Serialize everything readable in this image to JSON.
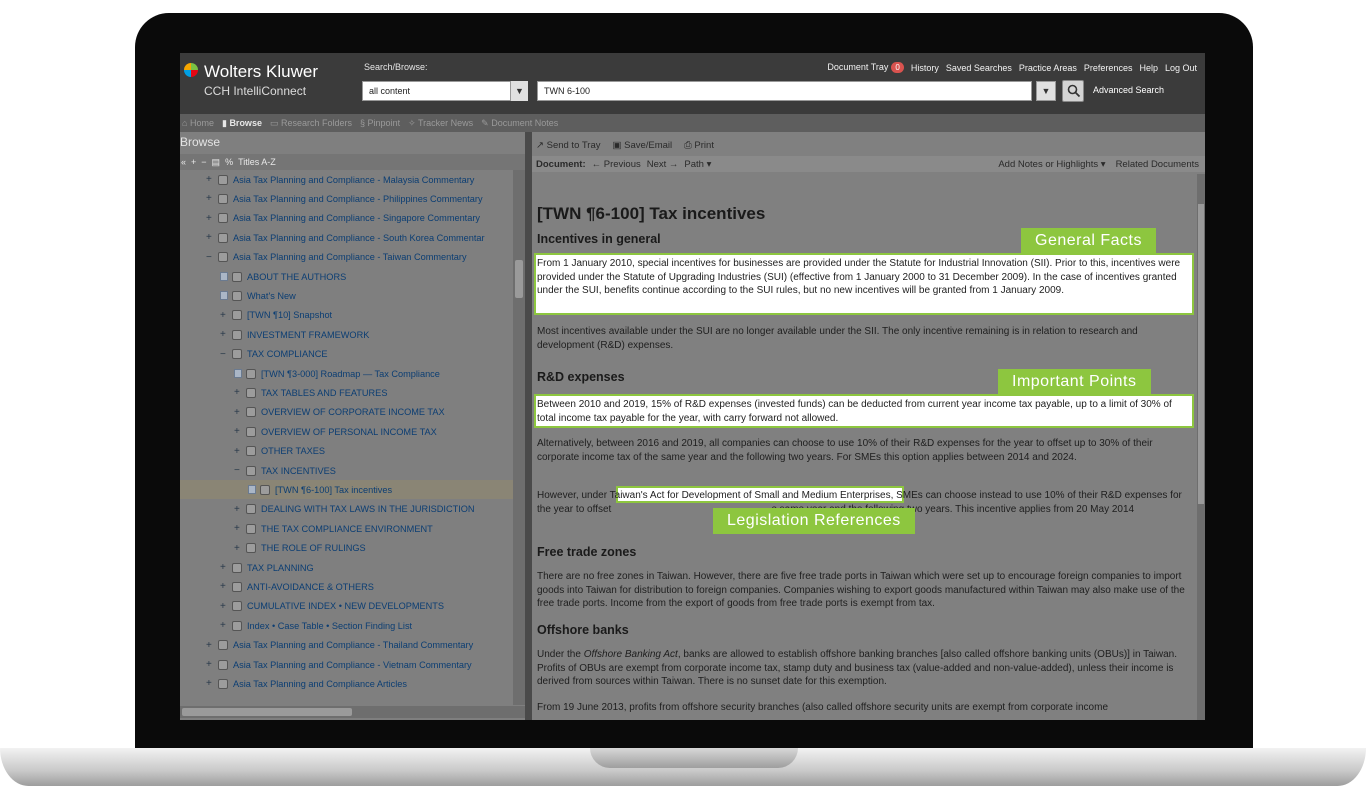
{
  "header": {
    "brand": "Wolters Kluwer",
    "brand_sub": "CCH IntelliConnect",
    "search_browse_label": "Search/Browse:",
    "scope_value": "all content",
    "search_value": "TWN 6-100",
    "advanced_search": "Advanced Search",
    "links": [
      "Document Tray",
      "History",
      "Saved Searches",
      "Practice Areas",
      "Preferences",
      "Help",
      "Log Out"
    ],
    "tray_count": "0"
  },
  "nav": {
    "home": "Home",
    "browse": "Browse",
    "research_folders": "Research Folders",
    "pinpoint": "Pinpoint",
    "tracker_news": "Tracker News",
    "document_notes": "Document Notes"
  },
  "left": {
    "title": "Browse",
    "sort_label": "Titles A-Z",
    "tree": [
      {
        "label": "Asia Tax Planning and Compliance - Malaysia Commentary",
        "toggle": "+",
        "indent": 0
      },
      {
        "label": "Asia Tax Planning and Compliance - Philippines Commentary",
        "toggle": "+",
        "indent": 0
      },
      {
        "label": "Asia Tax Planning and Compliance - Singapore Commentary",
        "toggle": "+",
        "indent": 0
      },
      {
        "label": "Asia Tax Planning and Compliance - South Korea Commentar",
        "toggle": "+",
        "indent": 0
      },
      {
        "label": "Asia Tax Planning and Compliance - Taiwan Commentary",
        "toggle": "−",
        "indent": 0
      },
      {
        "label": "ABOUT THE AUTHORS",
        "toggle": "doc",
        "indent": 1
      },
      {
        "label": "What's New",
        "toggle": "doc",
        "indent": 1
      },
      {
        "label": "[TWN ¶10] Snapshot",
        "toggle": "+",
        "indent": 1
      },
      {
        "label": "INVESTMENT FRAMEWORK",
        "toggle": "+",
        "indent": 1
      },
      {
        "label": "TAX COMPLIANCE",
        "toggle": "−",
        "indent": 1
      },
      {
        "label": "[TWN ¶3-000] Roadmap — Tax Compliance",
        "toggle": "doc",
        "indent": 2
      },
      {
        "label": "TAX TABLES AND FEATURES",
        "toggle": "+",
        "indent": 2
      },
      {
        "label": "OVERVIEW OF CORPORATE INCOME TAX",
        "toggle": "+",
        "indent": 2
      },
      {
        "label": "OVERVIEW OF PERSONAL INCOME TAX",
        "toggle": "+",
        "indent": 2
      },
      {
        "label": "OTHER TAXES",
        "toggle": "+",
        "indent": 2
      },
      {
        "label": "TAX INCENTIVES",
        "toggle": "−",
        "indent": 2
      },
      {
        "label": "[TWN ¶6-100] Tax incentives",
        "toggle": "doc",
        "indent": 3,
        "selected": true
      },
      {
        "label": "DEALING WITH TAX LAWS IN THE JURISDICTION",
        "toggle": "+",
        "indent": 2
      },
      {
        "label": "THE TAX COMPLIANCE ENVIRONMENT",
        "toggle": "+",
        "indent": 2
      },
      {
        "label": "THE ROLE OF RULINGS",
        "toggle": "+",
        "indent": 2
      },
      {
        "label": "TAX PLANNING",
        "toggle": "+",
        "indent": 1
      },
      {
        "label": "ANTI-AVOIDANCE & OTHERS",
        "toggle": "+",
        "indent": 1
      },
      {
        "label": "CUMULATIVE INDEX • NEW DEVELOPMENTS",
        "toggle": "+",
        "indent": 1
      },
      {
        "label": "Index • Case Table • Section Finding List",
        "toggle": "+",
        "indent": 1
      },
      {
        "label": "Asia Tax Planning and Compliance - Thailand Commentary",
        "toggle": "+",
        "indent": 0
      },
      {
        "label": "Asia Tax Planning and Compliance - Vietnam Commentary",
        "toggle": "+",
        "indent": 0
      },
      {
        "label": "Asia Tax Planning and Compliance Articles",
        "toggle": "+",
        "indent": 0
      }
    ]
  },
  "doc": {
    "send_to_tray": "Send to Tray",
    "save_email": "Save/Email",
    "print": "Print",
    "document_label": "Document:",
    "previous": "Previous",
    "next": "Next",
    "path": "Path",
    "add_notes": "Add Notes or Highlights",
    "related": "Related Documents",
    "title": "[TWN ¶6-100] Tax incentives",
    "h_incentives": "Incentives in general",
    "p1": "From 1 January 2010, special incentives for businesses are provided under the Statute for Industrial Innovation (SII). Prior to this, incentives were provided under the Statute of Upgrading Industries (SUI) (effective from 1 January 2000 to 31 December 2009). In the case of incentives granted under the SUI, benefits continue according to the SUI rules, but no new incentives will be granted from 1 January 2009.",
    "p2": "Most incentives available under the SUI are no longer available under the SII. The only incentive remaining is in relation to research and development (R&D) expenses.",
    "h_rd": "R&D expenses",
    "p3": "Between 2010 and 2019, 15% of R&D expenses (invested funds) can be deducted from current year income tax payable, up to a limit of 30% of total income tax payable for the year, with carry forward not allowed.",
    "p4": "Alternatively, between 2016 and 2019, all companies can choose to use 10% of their R&D expenses for the year to offset up to 30% of their corporate income tax of the same year and the following two years. For SMEs this option applies between 2014 and 2024.",
    "p5_a": "However, under ",
    "p5_law": "Taiwan's Act for Development of Small and Medium Enterprises,",
    "p5_b": " SMEs can choose instead to use 10% of their R&D expenses for the year to offset",
    "p5_c": "e same year and the following two years. This incentive applies from 20 May 2014",
    "h_ftz": "Free trade zones",
    "p6": "There are no free zones in Taiwan. However, there are five free trade ports in Taiwan which were set up to encourage foreign companies to import goods into Taiwan for distribution to foreign companies. Companies wishing to export goods manufactured within Taiwan may also make use of the free trade ports. Income from the export of goods from free trade ports is exempt from tax.",
    "h_offshore": "Offshore banks",
    "p7_a": "Under the ",
    "p7_act": "Offshore Banking Act",
    "p7_b": ", banks are allowed to establish offshore banking branches [also called offshore banking units (OBUs)] in Taiwan. Profits of OBUs are exempt from corporate income tax, stamp duty and business tax (value-added and non-value-added), unless their income is derived from sources within Taiwan. There is no sunset date for this exemption.",
    "p8": "From 19 June 2013, profits from offshore security branches (also called offshore security units are exempt from corporate income"
  },
  "callouts": {
    "general_facts": "General Facts",
    "important_points": "Important Points",
    "legislation_references": "Legislation References"
  },
  "colors": {
    "callout_green": "#8dc63f",
    "topbar": "#3b3b3b",
    "tree_text": "#0c3e73"
  }
}
